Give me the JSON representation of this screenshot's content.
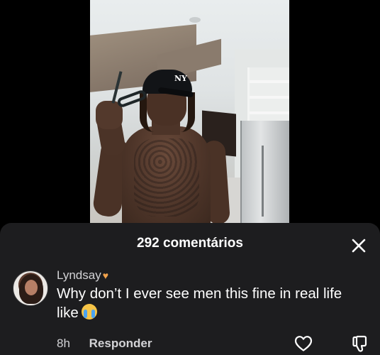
{
  "video": {
    "cap_logo": "NY"
  },
  "comments_sheet": {
    "title": "292 comentários",
    "close_icon": "close-icon"
  },
  "comment": {
    "username": "Lyndsay",
    "username_emoji": "heart-hands-emoji",
    "text": "Why don’t I ever see men this fine in real life like",
    "text_emoji": "loudly-crying-face-emoji",
    "time": "8h",
    "reply_label": "Responder",
    "like_icon": "heart-icon",
    "dislike_icon": "thumbs-down-icon"
  },
  "colors": {
    "sheet_bg": "#1d1d1f",
    "text_primary": "#ffffff",
    "text_secondary": "#d3d3d6"
  }
}
